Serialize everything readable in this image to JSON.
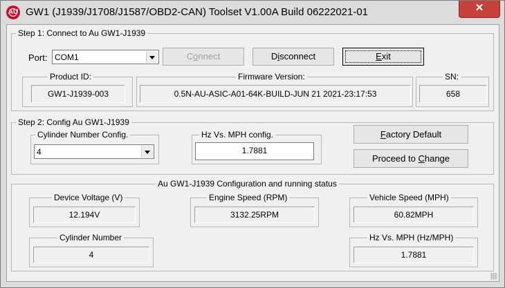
{
  "window": {
    "title": "GW1 (J1939/J1708/J1587/OBD2-CAN) Toolset V1.00A Build 06222021-01",
    "icon_text": "AU",
    "close_glyph": "✕"
  },
  "step1": {
    "title": "Step 1: Connect to Au GW1-J1939",
    "port_label": "Port:",
    "port_value": "COM1",
    "connect_pre": "C",
    "connect_ul": "o",
    "connect_post": "nnect",
    "disconnect_pre": "D",
    "disconnect_ul": "i",
    "disconnect_post": "sconnect",
    "exit_pre": "",
    "exit_ul": "E",
    "exit_post": "xit",
    "product_id_label": "Product ID:",
    "product_id_value": "GW1-J1939-003",
    "firmware_label": "Firmware Version:",
    "firmware_value": "0.5N-AU-ASIC-A01-64K-BUILD-JUN 21 2021-23:17:53",
    "sn_label": "SN:",
    "sn_value": "658"
  },
  "step2": {
    "title": "Step 2: Config Au GW1-J1939",
    "cylinder_label": "Cylinder Number Config.",
    "cylinder_value": "4",
    "hz_label": "Hz Vs. MPH config.",
    "hz_value": "1.7881",
    "factory_pre": "",
    "factory_ul": "F",
    "factory_post": "actory Default",
    "proceed_pre": "Proceed to ",
    "proceed_ul": "C",
    "proceed_post": "hange"
  },
  "status": {
    "title": "Au GW1-J1939 Configuration and running status",
    "voltage_label": "Device Voltage (V)",
    "voltage_value": "12.194V",
    "engine_label": "Engine Speed (RPM)",
    "engine_value": "3132.25RPM",
    "vehicle_label": "Vehicle Speed (MPH)",
    "vehicle_value": "60.82MPH",
    "cylinder_label": "Cylinder Number",
    "cylinder_value": "4",
    "hzmph_label": "Hz Vs. MPH (Hz/MPH)",
    "hzmph_value": "1.7881"
  }
}
